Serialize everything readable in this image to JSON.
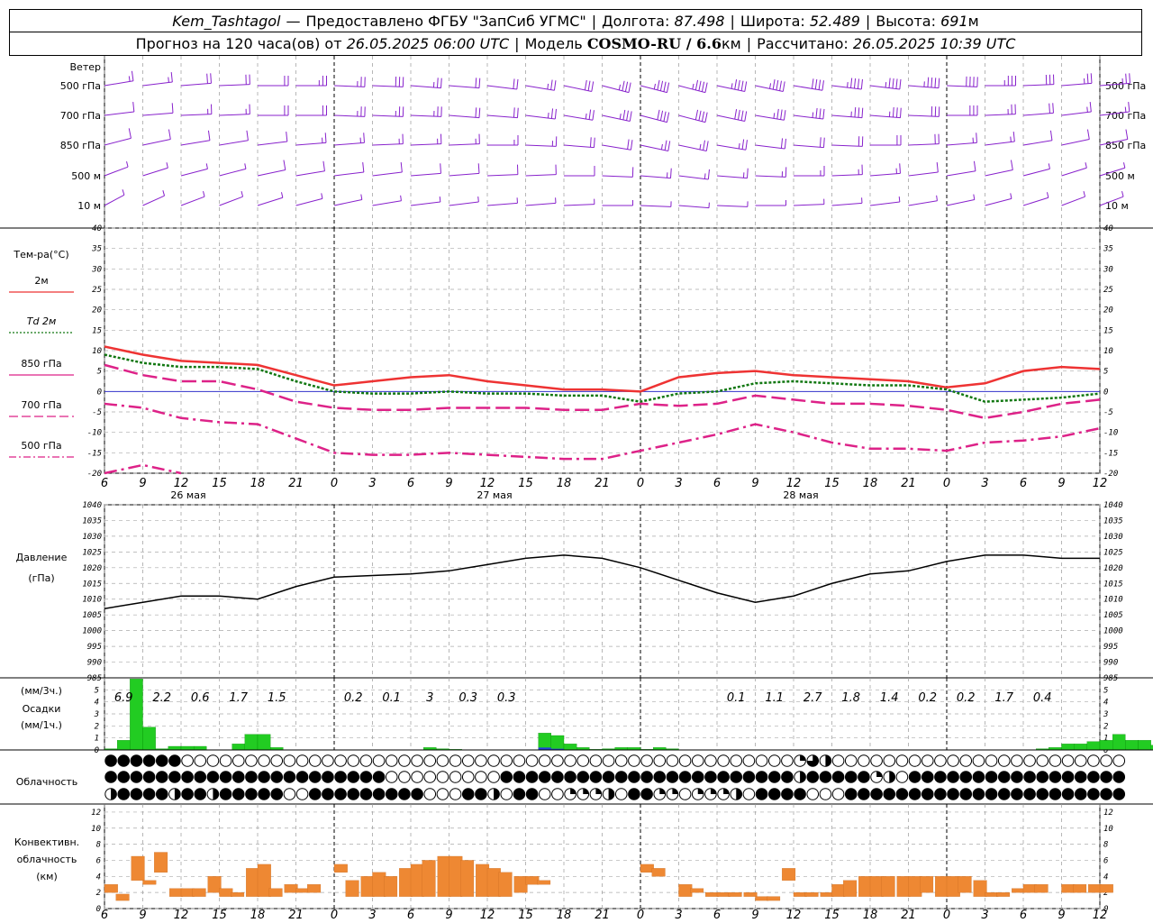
{
  "header": {
    "station": "Kem_Tashtagol",
    "dash": "—",
    "provider": "Предоставлено ФГБУ \"ЗапСиб УГМС\"",
    "lon_label": "Долгота:",
    "lon_value": "87.498",
    "lat_label": "Широта:",
    "lat_value": "52.489",
    "alt_label": "Высота:",
    "alt_value": "691",
    "alt_unit": "м",
    "forecast_label": "Прогноз на 120 часа(ов) от",
    "forecast_start": "26.05.2025 06:00 UTC",
    "model_label": "Модель",
    "model_name": "COSMO-RU / 6.6",
    "model_unit": "км",
    "calc_label": "Рассчитано:",
    "calc_time": "26.05.2025 10:39 UTC"
  },
  "panels": {
    "wind": {
      "title": "Ветер",
      "levels": [
        "500 гПа",
        "700 гПа",
        "850 гПа",
        "500 м",
        "10  м"
      ]
    },
    "temp": {
      "title": "Тем-ра(°С)",
      "legend": [
        "2м",
        "Td  2м",
        "850 гПа",
        "700 гПа",
        "500 гПа"
      ]
    },
    "pressure": {
      "title": "Давление",
      "unit": "(гПа)"
    },
    "precip": {
      "unit1": "(мм/3ч.)",
      "title": "Осадки",
      "unit2": "(мм/1ч.)"
    },
    "cloud": {
      "title": "Облачность"
    },
    "conv": {
      "title1": "Конвективн.",
      "title2": "облачность",
      "unit": "(км)"
    }
  },
  "colors": {
    "t2m": "#ee3333",
    "td2m": "#117711",
    "t850": "#dd2288",
    "t700": "#dd2288",
    "t500": "#dd2288",
    "zero_line": "#3333cc",
    "wind": "#8822cc",
    "precip_rain": "#22cc22",
    "precip_snow": "#2244dd",
    "conv": "#ee8833",
    "pressure": "#000000"
  },
  "x_axis": {
    "hour_labels": [
      "6",
      "9",
      "12",
      "15",
      "18",
      "21",
      "0",
      "3",
      "6",
      "9",
      "12",
      "15",
      "18",
      "21",
      "0",
      "3",
      "6",
      "9",
      "12",
      "15",
      "18",
      "21",
      "0",
      "3",
      "6",
      "9",
      "12"
    ],
    "day_labels": [
      "26 мая",
      "27 мая",
      "28 мая"
    ]
  },
  "chart_data": [
    {
      "type": "line",
      "title": "Тем-ра(°С)",
      "x": [
        0,
        1,
        2,
        3,
        4,
        5,
        6,
        7,
        8,
        9,
        10,
        11,
        12,
        13,
        14,
        15,
        16,
        17,
        18,
        19,
        20,
        21,
        22,
        23,
        24,
        25,
        26
      ],
      "x_unit": "3-hour steps from 26.05.2025 06:00 UTC",
      "ylim": [
        -20,
        40
      ],
      "yticks": [
        -20,
        -15,
        -10,
        -5,
        0,
        5,
        10,
        15,
        20,
        25,
        30,
        35,
        40
      ],
      "series": [
        {
          "name": "2м",
          "values": [
            11,
            9,
            7.5,
            7,
            6.5,
            4,
            1.5,
            2.5,
            3.5,
            4,
            2.5,
            1.5,
            0.5,
            0.5,
            0,
            3.5,
            4.5,
            5,
            4,
            3.5,
            3,
            2.5,
            1,
            2,
            5,
            6,
            5.5
          ]
        },
        {
          "name": "Td  2м",
          "values": [
            9,
            7,
            6,
            6,
            5.5,
            2.5,
            0,
            -0.5,
            -0.5,
            0,
            -0.5,
            -0.5,
            -1,
            -1,
            -2.5,
            -0.5,
            0,
            2,
            2.5,
            2,
            1.5,
            1.5,
            0.5,
            -2.5,
            -2,
            -1.5,
            -0.5
          ]
        },
        {
          "name": "850 гПа",
          "values": [
            6.5,
            4,
            2.5,
            2.5,
            0.5,
            -2.5,
            -4,
            -4.5,
            -4.5,
            -4,
            -4,
            -4,
            -4.5,
            -4.5,
            -3,
            -3.5,
            -3,
            -1,
            -2,
            -3,
            -3,
            -3.5,
            -4.5,
            -6.5,
            -5,
            -3,
            -2
          ]
        },
        {
          "name": "700 гПа",
          "values": [
            -3,
            -4,
            -6.5,
            -7.5,
            -8,
            -11.5,
            -15,
            -15.5,
            -15.5,
            -15,
            -15.5,
            -16,
            -16.5,
            -16.5,
            -14.5,
            -12.5,
            -10.5,
            -8,
            -10,
            -12.5,
            -14,
            -14,
            -14.5,
            -12.5,
            -12,
            -11,
            -9
          ]
        },
        {
          "name": "500 гПа",
          "values": [
            -20,
            -18,
            -20
          ]
        }
      ]
    },
    {
      "type": "line",
      "title": "Давление",
      "x": [
        0,
        1,
        2,
        3,
        4,
        5,
        6,
        7,
        8,
        9,
        10,
        11,
        12,
        13,
        14,
        15,
        16,
        17,
        18,
        19,
        20,
        21,
        22,
        23,
        24,
        25,
        26
      ],
      "ylim": [
        985,
        1040
      ],
      "yticks": [
        985,
        990,
        995,
        1000,
        1005,
        1010,
        1015,
        1020,
        1025,
        1030,
        1035,
        1040
      ],
      "series": [
        {
          "name": "Давление",
          "values": [
            1007,
            1009,
            1011,
            1011,
            1010,
            1014,
            1017,
            1017.5,
            1018,
            1019,
            1021,
            1023,
            1024,
            1023,
            1020,
            1016,
            1012,
            1009,
            1011,
            1015,
            1018,
            1019,
            1022,
            1024,
            1024,
            1023,
            1023
          ]
        }
      ]
    },
    {
      "type": "bar",
      "title": "Осадки",
      "ylim": [
        0,
        6
      ],
      "yticks": [
        0,
        1,
        2,
        3,
        4,
        5
      ],
      "totals_3h": [
        {
          "x": 0.5,
          "value": "6.9"
        },
        {
          "x": 1.5,
          "value": "2.2"
        },
        {
          "x": 2.5,
          "value": "0.6"
        },
        {
          "x": 3.5,
          "value": "1.7"
        },
        {
          "x": 4.5,
          "value": "1.5"
        },
        {
          "x": 6.5,
          "value": "0.2"
        },
        {
          "x": 7.5,
          "value": "0.1"
        },
        {
          "x": 8.5,
          "value": "3"
        },
        {
          "x": 9.5,
          "value": "0.3"
        },
        {
          "x": 10.5,
          "value": "0.3"
        },
        {
          "x": 16.5,
          "value": "0.1"
        },
        {
          "x": 17.5,
          "value": "1.1"
        },
        {
          "x": 18.5,
          "value": "2.7"
        },
        {
          "x": 19.5,
          "value": "1.8"
        },
        {
          "x": 20.5,
          "value": "1.4"
        },
        {
          "x": 21.5,
          "value": "0.2"
        },
        {
          "x": 22.5,
          "value": "0.2"
        },
        {
          "x": 23.5,
          "value": "1.7"
        },
        {
          "x": 24.5,
          "value": "0.4"
        }
      ],
      "hourly": [
        0.1,
        0.8,
        5.9,
        1.9,
        0.1,
        0.3,
        0.3,
        0.3,
        0,
        0,
        0.5,
        1.3,
        1.3,
        0.2,
        0,
        0,
        0,
        0,
        0,
        0,
        0,
        0,
        0,
        0,
        0,
        0.2,
        0.1,
        0.05,
        0,
        0,
        0,
        0,
        0,
        0,
        1.4,
        1.2,
        0.5,
        0.2,
        0.05,
        0.1,
        0.2,
        0.2,
        0.05,
        0.2,
        0.1,
        0,
        0,
        0,
        0,
        0,
        0,
        0,
        0,
        0,
        0,
        0,
        0,
        0,
        0,
        0,
        0,
        0,
        0,
        0,
        0,
        0,
        0,
        0,
        0,
        0,
        0,
        0,
        0,
        0.1,
        0.2,
        0.5,
        0.5,
        0.7,
        0.8,
        1.3,
        0.8,
        0.8,
        0.4,
        0.3,
        0.4,
        0.6,
        0.2,
        0.1,
        0,
        0,
        0,
        0.05,
        0.1,
        0.2,
        0.8,
        0.5,
        0.6,
        0.5,
        0.1,
        0,
        0,
        0,
        0,
        0,
        0,
        0,
        0,
        0,
        0,
        0,
        0,
        0,
        0,
        0,
        0,
        0,
        0,
        0,
        0,
        0,
        0
      ],
      "hourly_snow": [
        {
          "i": 34,
          "v": 0.2
        },
        {
          "i": 35,
          "v": 0.1
        },
        {
          "i": 96,
          "v": 0.3
        },
        {
          "i": 97,
          "v": 0.6
        }
      ]
    },
    {
      "type": "bar",
      "title": "Конвективн. облачность",
      "ylim": [
        0,
        13
      ],
      "yticks": [
        0,
        2,
        4,
        6,
        8,
        10,
        12
      ],
      "segments": [
        {
          "x": 0,
          "b": 2,
          "t": 3
        },
        {
          "x": 0.3,
          "b": 1,
          "t": 1.8
        },
        {
          "x": 0.7,
          "b": 3.5,
          "t": 6.5
        },
        {
          "x": 1.0,
          "b": 3,
          "t": 3.5
        },
        {
          "x": 1.3,
          "b": 4.5,
          "t": 7
        },
        {
          "x": 1.7,
          "b": 1.5,
          "t": 2.5
        },
        {
          "x": 2.0,
          "b": 1.5,
          "t": 2.5
        },
        {
          "x": 2.3,
          "b": 1.5,
          "t": 2.5
        },
        {
          "x": 2.7,
          "b": 2,
          "t": 4
        },
        {
          "x": 3.0,
          "b": 1.5,
          "t": 2.5
        },
        {
          "x": 3.3,
          "b": 1.5,
          "t": 2
        },
        {
          "x": 3.7,
          "b": 1.5,
          "t": 5
        },
        {
          "x": 4.0,
          "b": 1.5,
          "t": 5.5
        },
        {
          "x": 4.3,
          "b": 1.5,
          "t": 2.5
        },
        {
          "x": 4.7,
          "b": 2,
          "t": 3
        },
        {
          "x": 5.0,
          "b": 2,
          "t": 2.5
        },
        {
          "x": 5.3,
          "b": 2,
          "t": 3
        },
        {
          "x": 6.0,
          "b": 4.5,
          "t": 5.5
        },
        {
          "x": 6.3,
          "b": 1.5,
          "t": 3.5
        },
        {
          "x": 6.7,
          "b": 1.5,
          "t": 4
        },
        {
          "x": 7.0,
          "b": 1.5,
          "t": 4.5
        },
        {
          "x": 7.3,
          "b": 1.5,
          "t": 4
        },
        {
          "x": 7.7,
          "b": 1.5,
          "t": 5
        },
        {
          "x": 8.0,
          "b": 1.5,
          "t": 5.5
        },
        {
          "x": 8.3,
          "b": 1.5,
          "t": 6
        },
        {
          "x": 8.7,
          "b": 1.5,
          "t": 6.5
        },
        {
          "x": 9.0,
          "b": 1.5,
          "t": 6.5
        },
        {
          "x": 9.3,
          "b": 1.5,
          "t": 6
        },
        {
          "x": 9.7,
          "b": 1.5,
          "t": 5.5
        },
        {
          "x": 10.0,
          "b": 1.5,
          "t": 5
        },
        {
          "x": 10.3,
          "b": 1.5,
          "t": 4.5
        },
        {
          "x": 10.7,
          "b": 2,
          "t": 4
        },
        {
          "x": 11.0,
          "b": 3,
          "t": 4
        },
        {
          "x": 11.3,
          "b": 3,
          "t": 3.5
        },
        {
          "x": 14.0,
          "b": 4.5,
          "t": 5.5
        },
        {
          "x": 14.3,
          "b": 4,
          "t": 5
        },
        {
          "x": 15.0,
          "b": 1.5,
          "t": 3
        },
        {
          "x": 15.3,
          "b": 2,
          "t": 2.5
        },
        {
          "x": 15.7,
          "b": 1.5,
          "t": 2
        },
        {
          "x": 16.0,
          "b": 1.5,
          "t": 2
        },
        {
          "x": 16.3,
          "b": 1.5,
          "t": 2
        },
        {
          "x": 16.7,
          "b": 1.5,
          "t": 2
        },
        {
          "x": 17.0,
          "b": 1,
          "t": 1.5
        },
        {
          "x": 17.3,
          "b": 1,
          "t": 1.5
        },
        {
          "x": 17.7,
          "b": 3.5,
          "t": 5
        },
        {
          "x": 18.0,
          "b": 1.5,
          "t": 2
        },
        {
          "x": 18.3,
          "b": 1.5,
          "t": 2
        },
        {
          "x": 18.7,
          "b": 1.5,
          "t": 2
        },
        {
          "x": 19.0,
          "b": 1.5,
          "t": 3
        },
        {
          "x": 19.3,
          "b": 1.5,
          "t": 3.5
        },
        {
          "x": 19.7,
          "b": 1.5,
          "t": 4
        },
        {
          "x": 20.0,
          "b": 1.5,
          "t": 4
        },
        {
          "x": 20.3,
          "b": 1.5,
          "t": 4
        },
        {
          "x": 20.7,
          "b": 1.5,
          "t": 4
        },
        {
          "x": 21.0,
          "b": 1.5,
          "t": 4
        },
        {
          "x": 21.3,
          "b": 2,
          "t": 4
        },
        {
          "x": 21.7,
          "b": 1.5,
          "t": 4
        },
        {
          "x": 22.0,
          "b": 1.5,
          "t": 4
        },
        {
          "x": 22.3,
          "b": 2,
          "t": 4
        },
        {
          "x": 22.7,
          "b": 1.5,
          "t": 3.5
        },
        {
          "x": 23.0,
          "b": 1.5,
          "t": 2
        },
        {
          "x": 23.3,
          "b": 1.5,
          "t": 2
        },
        {
          "x": 23.7,
          "b": 2,
          "t": 2.5
        },
        {
          "x": 24.0,
          "b": 2,
          "t": 3
        },
        {
          "x": 24.3,
          "b": 2,
          "t": 3
        },
        {
          "x": 25.0,
          "b": 2,
          "t": 3
        },
        {
          "x": 25.3,
          "b": 2,
          "t": 3
        },
        {
          "x": 25.7,
          "b": 2,
          "t": 3
        },
        {
          "x": 26.0,
          "b": 2,
          "t": 3
        }
      ]
    }
  ],
  "wind_rows": [
    {
      "level": "500 гПа",
      "speeds": [
        14,
        14,
        17,
        16,
        18,
        20,
        21,
        24,
        20,
        19,
        18,
        22,
        24,
        30,
        36,
        36,
        38,
        36,
        35,
        38,
        38,
        36,
        32,
        28,
        24,
        22,
        22
      ],
      "dirs": [
        250,
        255,
        260,
        265,
        270,
        270,
        275,
        275,
        280,
        280,
        285,
        290,
        295,
        300,
        300,
        300,
        295,
        295,
        290,
        285,
        285,
        280,
        275,
        270,
        265,
        260,
        260
      ]
    },
    {
      "level": "700 гПа",
      "speeds": [
        10,
        11,
        12,
        14,
        16,
        18,
        20,
        22,
        20,
        18,
        18,
        20,
        22,
        28,
        32,
        34,
        34,
        30,
        28,
        30,
        30,
        26,
        24,
        20,
        16,
        14,
        14
      ],
      "dirs": [
        255,
        260,
        265,
        265,
        270,
        270,
        275,
        275,
        275,
        280,
        280,
        285,
        290,
        295,
        300,
        300,
        295,
        290,
        285,
        280,
        280,
        275,
        270,
        265,
        260,
        255,
        255
      ]
    },
    {
      "level": "850 гПа",
      "speeds": [
        8,
        8,
        9,
        10,
        10,
        12,
        12,
        14,
        14,
        12,
        12,
        14,
        16,
        18,
        22,
        22,
        20,
        18,
        18,
        18,
        18,
        16,
        14,
        12,
        10,
        10,
        10
      ],
      "dirs": [
        240,
        245,
        250,
        250,
        255,
        260,
        260,
        265,
        265,
        265,
        270,
        275,
        280,
        290,
        295,
        295,
        290,
        285,
        280,
        275,
        270,
        265,
        260,
        255,
        250,
        245,
        245
      ]
    },
    {
      "level": "500 м",
      "speeds": [
        6,
        6,
        6,
        7,
        8,
        8,
        8,
        9,
        9,
        8,
        8,
        8,
        8,
        10,
        12,
        14,
        12,
        12,
        12,
        12,
        12,
        10,
        8,
        8,
        6,
        6,
        6
      ],
      "dirs": [
        230,
        235,
        240,
        240,
        245,
        250,
        255,
        255,
        260,
        260,
        265,
        265,
        270,
        275,
        280,
        285,
        280,
        275,
        270,
        265,
        260,
        255,
        250,
        245,
        240,
        235,
        235
      ]
    },
    {
      "level": "10  м",
      "speeds": [
        4,
        4,
        4,
        4,
        4,
        4,
        4,
        5,
        5,
        4,
        4,
        4,
        4,
        5,
        6,
        6,
        6,
        5,
        5,
        5,
        5,
        4,
        4,
        4,
        4,
        4,
        4
      ],
      "dirs": [
        220,
        225,
        230,
        230,
        235,
        240,
        245,
        250,
        255,
        255,
        260,
        260,
        265,
        270,
        275,
        280,
        275,
        270,
        265,
        260,
        255,
        250,
        245,
        240,
        235,
        230,
        230
      ]
    }
  ],
  "cloud_rows": {
    "symbols": [
      "full",
      "empty",
      "half",
      "quarter",
      "threequarter"
    ],
    "top": "ffffffeeeeeeeeeeeeeeeeeeeeeeeeeeeeeeeeeeeeeeeeeeeeeeeeqtheeeeeeeeeeeeeeeeeeeeeeeeeeeeeeeeeeeeeeeeffffeeeeeeeeeeeeeeeeeeeeeeeeeeeeeeeqeeeee",
    "mid": "ffffffffffffffffffffffeeeeeeeeefffffffffffffffffffffffhfffffqheffffffffffffffffffhqhfffffffffffffffffffffffffffffffffffffffffffffffefffffqteeeeeeee",
    "bottom": "hffffhffhfffffeefffffffffeeeffheffeeqqqheffqqeqqqheffffeeefffffffffffffffffffffffffffffffffffffffffffffffffffffffhfffhhqhhhhhhhhhqhhhhh"
  }
}
